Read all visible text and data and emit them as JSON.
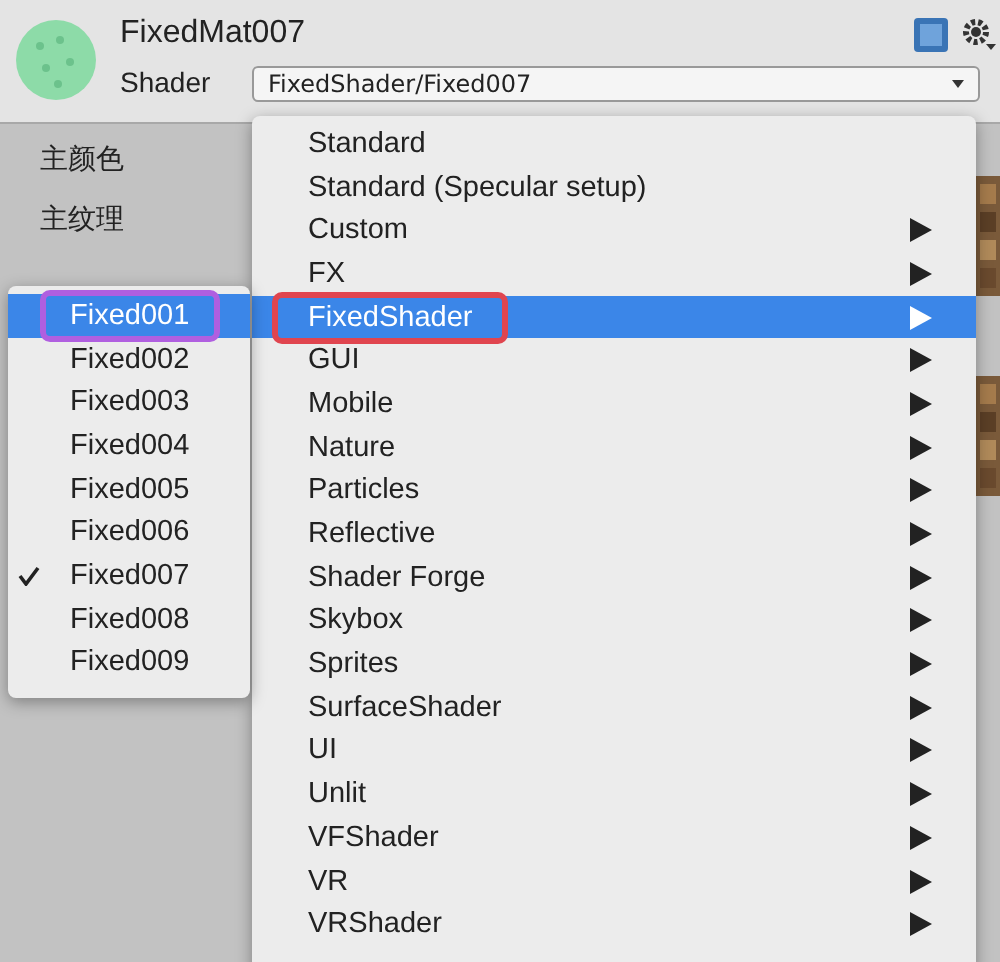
{
  "material": {
    "name": "FixedMat007",
    "shader_label": "Shader",
    "shader_value": "FixedShader/Fixed007"
  },
  "properties": [
    "主颜色",
    "主纹理"
  ],
  "shader_menu": {
    "items": [
      {
        "label": "Standard",
        "submenu": false,
        "selected": false,
        "outlined": false
      },
      {
        "label": "Standard (Specular setup)",
        "submenu": false,
        "selected": false,
        "outlined": false
      },
      {
        "label": "Custom",
        "submenu": true,
        "selected": false,
        "outlined": false
      },
      {
        "label": "FX",
        "submenu": true,
        "selected": false,
        "outlined": false
      },
      {
        "label": "FixedShader",
        "submenu": true,
        "selected": true,
        "outlined": true
      },
      {
        "label": "GUI",
        "submenu": true,
        "selected": false,
        "outlined": false
      },
      {
        "label": "Mobile",
        "submenu": true,
        "selected": false,
        "outlined": false
      },
      {
        "label": "Nature",
        "submenu": true,
        "selected": false,
        "outlined": false
      },
      {
        "label": "Particles",
        "submenu": true,
        "selected": false,
        "outlined": false
      },
      {
        "label": "Reflective",
        "submenu": true,
        "selected": false,
        "outlined": false
      },
      {
        "label": "Shader Forge",
        "submenu": true,
        "selected": false,
        "outlined": false
      },
      {
        "label": "Skybox",
        "submenu": true,
        "selected": false,
        "outlined": false
      },
      {
        "label": "Sprites",
        "submenu": true,
        "selected": false,
        "outlined": false
      },
      {
        "label": "SurfaceShader",
        "submenu": true,
        "selected": false,
        "outlined": false
      },
      {
        "label": "UI",
        "submenu": true,
        "selected": false,
        "outlined": false
      },
      {
        "label": "Unlit",
        "submenu": true,
        "selected": false,
        "outlined": false
      },
      {
        "label": "VFShader",
        "submenu": true,
        "selected": false,
        "outlined": false
      },
      {
        "label": "VR",
        "submenu": true,
        "selected": false,
        "outlined": false
      },
      {
        "label": "VRShader",
        "submenu": true,
        "selected": false,
        "outlined": false
      }
    ]
  },
  "submenu": {
    "items": [
      {
        "label": "Fixed001",
        "checked": false,
        "selected": true,
        "outlined": true
      },
      {
        "label": "Fixed002",
        "checked": false,
        "selected": false,
        "outlined": false
      },
      {
        "label": "Fixed003",
        "checked": false,
        "selected": false,
        "outlined": false
      },
      {
        "label": "Fixed004",
        "checked": false,
        "selected": false,
        "outlined": false
      },
      {
        "label": "Fixed005",
        "checked": false,
        "selected": false,
        "outlined": false
      },
      {
        "label": "Fixed006",
        "checked": false,
        "selected": false,
        "outlined": false
      },
      {
        "label": "Fixed007",
        "checked": true,
        "selected": false,
        "outlined": false
      },
      {
        "label": "Fixed008",
        "checked": false,
        "selected": false,
        "outlined": false
      },
      {
        "label": "Fixed009",
        "checked": false,
        "selected": false,
        "outlined": false
      }
    ]
  }
}
